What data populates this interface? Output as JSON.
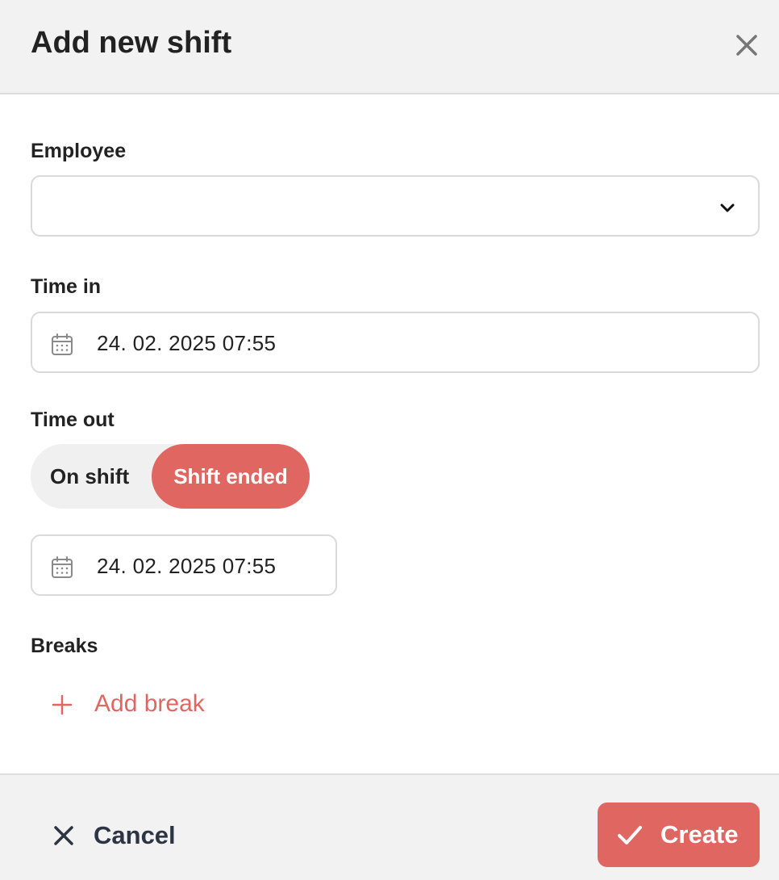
{
  "header": {
    "title": "Add new shift",
    "close_icon": "close-icon"
  },
  "form": {
    "employee": {
      "label": "Employee",
      "value": "",
      "icon": "chevron-down-icon"
    },
    "time_in": {
      "label": "Time in",
      "value": "24. 02. 2025 07:55",
      "icon": "calendar-icon"
    },
    "time_out": {
      "label": "Time out",
      "toggle": {
        "options": [
          "On shift",
          "Shift ended"
        ],
        "selected": "Shift ended"
      },
      "value": "24. 02. 2025 07:55",
      "icon": "calendar-icon"
    },
    "breaks": {
      "label": "Breaks",
      "add_label": "Add break",
      "icon": "plus-icon"
    }
  },
  "footer": {
    "cancel_label": "Cancel",
    "cancel_icon": "close-icon",
    "create_label": "Create",
    "create_icon": "check-icon"
  },
  "colors": {
    "accent": "#e06661",
    "header_bg": "#f2f2f2",
    "text": "#222222"
  }
}
